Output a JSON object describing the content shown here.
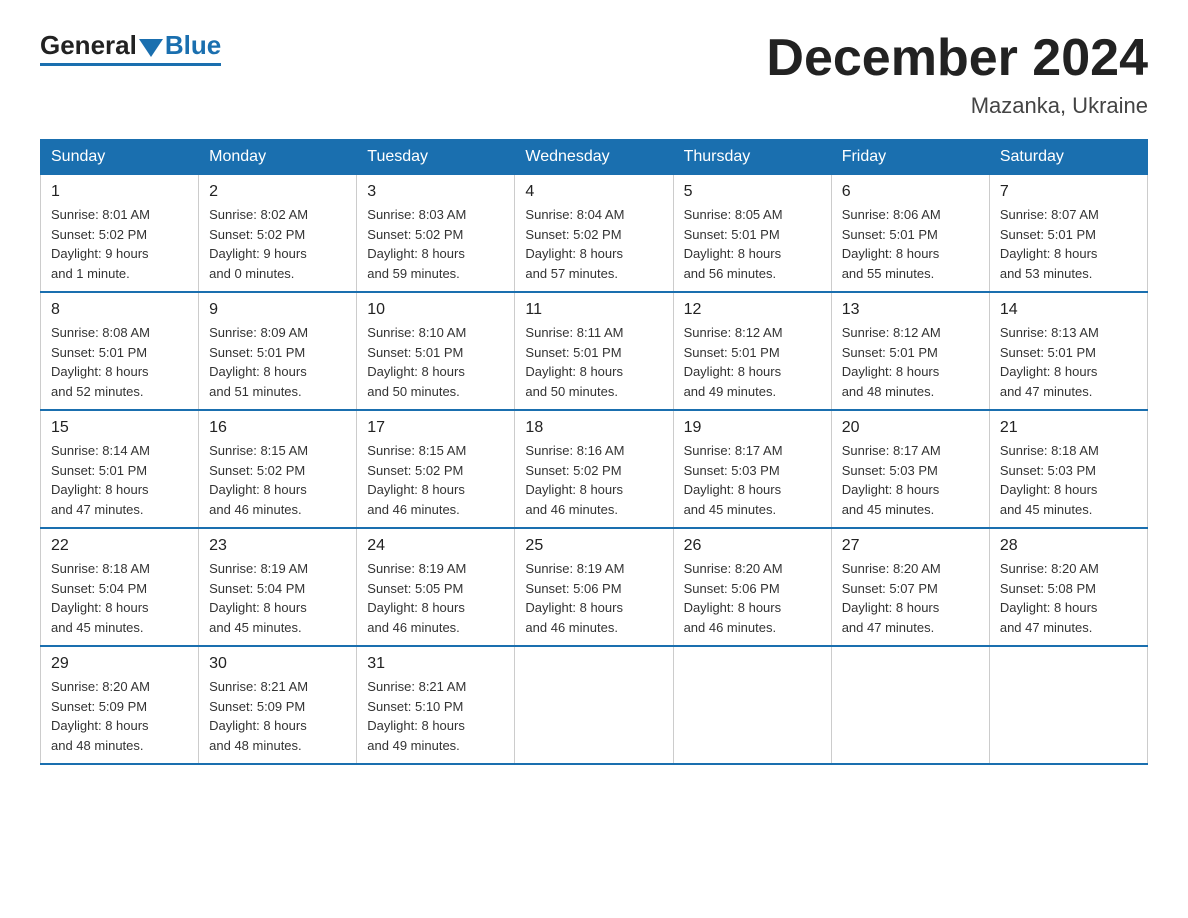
{
  "logo": {
    "general": "General",
    "blue": "Blue"
  },
  "title": "December 2024",
  "location": "Mazanka, Ukraine",
  "days_header": [
    "Sunday",
    "Monday",
    "Tuesday",
    "Wednesday",
    "Thursday",
    "Friday",
    "Saturday"
  ],
  "weeks": [
    [
      {
        "day": "1",
        "info": "Sunrise: 8:01 AM\nSunset: 5:02 PM\nDaylight: 9 hours\nand 1 minute."
      },
      {
        "day": "2",
        "info": "Sunrise: 8:02 AM\nSunset: 5:02 PM\nDaylight: 9 hours\nand 0 minutes."
      },
      {
        "day": "3",
        "info": "Sunrise: 8:03 AM\nSunset: 5:02 PM\nDaylight: 8 hours\nand 59 minutes."
      },
      {
        "day": "4",
        "info": "Sunrise: 8:04 AM\nSunset: 5:02 PM\nDaylight: 8 hours\nand 57 minutes."
      },
      {
        "day": "5",
        "info": "Sunrise: 8:05 AM\nSunset: 5:01 PM\nDaylight: 8 hours\nand 56 minutes."
      },
      {
        "day": "6",
        "info": "Sunrise: 8:06 AM\nSunset: 5:01 PM\nDaylight: 8 hours\nand 55 minutes."
      },
      {
        "day": "7",
        "info": "Sunrise: 8:07 AM\nSunset: 5:01 PM\nDaylight: 8 hours\nand 53 minutes."
      }
    ],
    [
      {
        "day": "8",
        "info": "Sunrise: 8:08 AM\nSunset: 5:01 PM\nDaylight: 8 hours\nand 52 minutes."
      },
      {
        "day": "9",
        "info": "Sunrise: 8:09 AM\nSunset: 5:01 PM\nDaylight: 8 hours\nand 51 minutes."
      },
      {
        "day": "10",
        "info": "Sunrise: 8:10 AM\nSunset: 5:01 PM\nDaylight: 8 hours\nand 50 minutes."
      },
      {
        "day": "11",
        "info": "Sunrise: 8:11 AM\nSunset: 5:01 PM\nDaylight: 8 hours\nand 50 minutes."
      },
      {
        "day": "12",
        "info": "Sunrise: 8:12 AM\nSunset: 5:01 PM\nDaylight: 8 hours\nand 49 minutes."
      },
      {
        "day": "13",
        "info": "Sunrise: 8:12 AM\nSunset: 5:01 PM\nDaylight: 8 hours\nand 48 minutes."
      },
      {
        "day": "14",
        "info": "Sunrise: 8:13 AM\nSunset: 5:01 PM\nDaylight: 8 hours\nand 47 minutes."
      }
    ],
    [
      {
        "day": "15",
        "info": "Sunrise: 8:14 AM\nSunset: 5:01 PM\nDaylight: 8 hours\nand 47 minutes."
      },
      {
        "day": "16",
        "info": "Sunrise: 8:15 AM\nSunset: 5:02 PM\nDaylight: 8 hours\nand 46 minutes."
      },
      {
        "day": "17",
        "info": "Sunrise: 8:15 AM\nSunset: 5:02 PM\nDaylight: 8 hours\nand 46 minutes."
      },
      {
        "day": "18",
        "info": "Sunrise: 8:16 AM\nSunset: 5:02 PM\nDaylight: 8 hours\nand 46 minutes."
      },
      {
        "day": "19",
        "info": "Sunrise: 8:17 AM\nSunset: 5:03 PM\nDaylight: 8 hours\nand 45 minutes."
      },
      {
        "day": "20",
        "info": "Sunrise: 8:17 AM\nSunset: 5:03 PM\nDaylight: 8 hours\nand 45 minutes."
      },
      {
        "day": "21",
        "info": "Sunrise: 8:18 AM\nSunset: 5:03 PM\nDaylight: 8 hours\nand 45 minutes."
      }
    ],
    [
      {
        "day": "22",
        "info": "Sunrise: 8:18 AM\nSunset: 5:04 PM\nDaylight: 8 hours\nand 45 minutes."
      },
      {
        "day": "23",
        "info": "Sunrise: 8:19 AM\nSunset: 5:04 PM\nDaylight: 8 hours\nand 45 minutes."
      },
      {
        "day": "24",
        "info": "Sunrise: 8:19 AM\nSunset: 5:05 PM\nDaylight: 8 hours\nand 46 minutes."
      },
      {
        "day": "25",
        "info": "Sunrise: 8:19 AM\nSunset: 5:06 PM\nDaylight: 8 hours\nand 46 minutes."
      },
      {
        "day": "26",
        "info": "Sunrise: 8:20 AM\nSunset: 5:06 PM\nDaylight: 8 hours\nand 46 minutes."
      },
      {
        "day": "27",
        "info": "Sunrise: 8:20 AM\nSunset: 5:07 PM\nDaylight: 8 hours\nand 47 minutes."
      },
      {
        "day": "28",
        "info": "Sunrise: 8:20 AM\nSunset: 5:08 PM\nDaylight: 8 hours\nand 47 minutes."
      }
    ],
    [
      {
        "day": "29",
        "info": "Sunrise: 8:20 AM\nSunset: 5:09 PM\nDaylight: 8 hours\nand 48 minutes."
      },
      {
        "day": "30",
        "info": "Sunrise: 8:21 AM\nSunset: 5:09 PM\nDaylight: 8 hours\nand 48 minutes."
      },
      {
        "day": "31",
        "info": "Sunrise: 8:21 AM\nSunset: 5:10 PM\nDaylight: 8 hours\nand 49 minutes."
      },
      {
        "day": "",
        "info": ""
      },
      {
        "day": "",
        "info": ""
      },
      {
        "day": "",
        "info": ""
      },
      {
        "day": "",
        "info": ""
      }
    ]
  ],
  "colors": {
    "header_bg": "#1a6faf",
    "header_text": "#ffffff",
    "border": "#1a6faf"
  }
}
